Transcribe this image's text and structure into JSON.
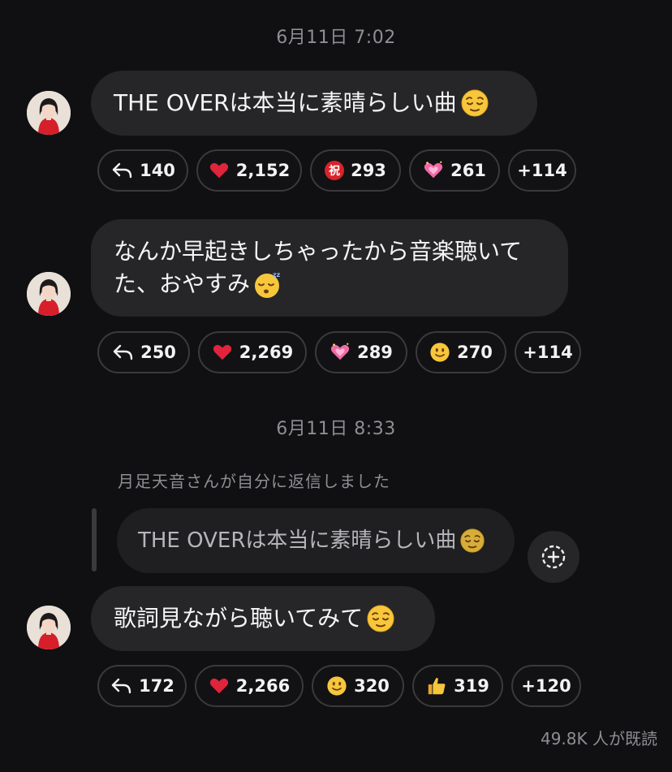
{
  "timestamps": [
    "6月11日 7:02",
    "6月11日 8:33"
  ],
  "messages": [
    {
      "text": "THE OVERは本当に素晴らしい曲",
      "emoji": "relieved-face",
      "reactions": [
        {
          "icon": "reply-arrow-icon",
          "count": "140"
        },
        {
          "icon": "red-heart-icon",
          "count": "2,152"
        },
        {
          "icon": "congratulations-kanji-icon",
          "symbol": "祝",
          "count": "293"
        },
        {
          "icon": "sparkling-heart-icon",
          "count": "261"
        },
        {
          "more": "+114"
        }
      ]
    },
    {
      "line1": "なんか早起きしちゃったから音楽聴いて",
      "line2": "た、おやすみ",
      "emoji": "sleeping-face",
      "reactions": [
        {
          "icon": "reply-arrow-icon",
          "count": "250"
        },
        {
          "icon": "red-heart-icon",
          "count": "2,269"
        },
        {
          "icon": "sparkling-heart-icon",
          "count": "289"
        },
        {
          "icon": "slightly-smiling-face-icon",
          "count": "270"
        },
        {
          "more": "+114"
        }
      ]
    },
    {
      "reply_note": "月足天音さんが自分に返信しました",
      "quoted_text": "THE OVERは本当に素晴らしい曲",
      "text": "歌詞見ながら聴いてみて",
      "emoji": "relieved-face",
      "reactions": [
        {
          "icon": "reply-arrow-icon",
          "count": "172"
        },
        {
          "icon": "red-heart-icon",
          "count": "2,266"
        },
        {
          "icon": "slightly-smiling-face-icon",
          "count": "320"
        },
        {
          "icon": "thumbs-up-icon",
          "count": "319"
        },
        {
          "more": "+120"
        }
      ]
    }
  ],
  "seen_count": "49.8K 人が既読",
  "colors": {
    "background": "#101012",
    "bubble": "#262628",
    "muted_text": "#8e8e93",
    "heart": "#e0243c"
  }
}
